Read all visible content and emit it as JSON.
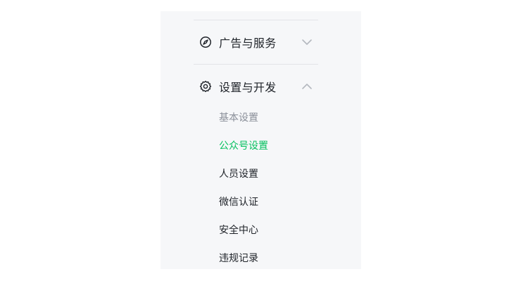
{
  "nav": {
    "sections": [
      {
        "label": "广告与服务",
        "icon": "compass-icon",
        "expanded": false
      },
      {
        "label": "设置与开发",
        "icon": "gear-icon",
        "expanded": true
      }
    ],
    "settings_items": [
      {
        "label": "基本设置",
        "state": "muted"
      },
      {
        "label": "公众号设置",
        "state": "active"
      },
      {
        "label": "人员设置",
        "state": "normal"
      },
      {
        "label": "微信认证",
        "state": "normal"
      },
      {
        "label": "安全中心",
        "state": "normal"
      },
      {
        "label": "违规记录",
        "state": "normal"
      }
    ]
  },
  "colors": {
    "panel_bg": "#f6f7f9",
    "text": "#1f2329",
    "muted": "#8a8f99",
    "active": "#07c160",
    "divider": "#e3e4e8"
  }
}
